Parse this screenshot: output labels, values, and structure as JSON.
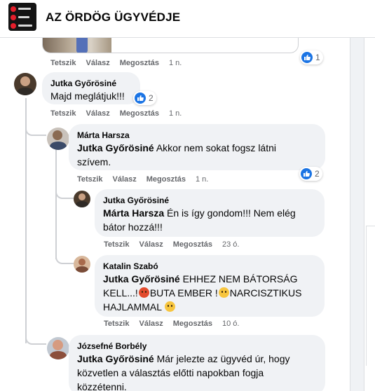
{
  "header": {
    "title": "AZ ÖRDÖG ÜGYVÉDJE"
  },
  "previous_comment": {
    "reactions": {
      "count": "1"
    },
    "actions": {
      "like": "Tetszik",
      "reply": "Válasz",
      "share": "Megosztás",
      "time": "1 n."
    }
  },
  "comments": [
    {
      "author": "Jutka Győrösiné",
      "text": "Majd meglátjuk!!!",
      "reactions": "2",
      "like": "Tetszik",
      "reply": "Válasz",
      "share": "Megosztás",
      "time": "1 n."
    },
    {
      "author": "Márta Harsza",
      "mention": "Jutka Győrösiné",
      "text_line1": " Akkor nem sokat fogsz látni",
      "text_line2": "szívem.",
      "reactions": "2",
      "like": "Tetszik",
      "reply": "Válasz",
      "share": "Megosztás",
      "time": "1 n."
    },
    {
      "author": "Jutka Győrösiné",
      "mention": "Márta Harsza",
      "text_line1": " Én is így gondom!!! Nem elég",
      "text_line2": "bátor hozzá!!!",
      "like": "Tetszik",
      "reply": "Válasz",
      "share": "Megosztás",
      "time": "23 ó."
    },
    {
      "author": "Katalin Szabó",
      "mention": "Jutka Győrösiné",
      "text_line1": " EHHEZ NEM BÁTORSÁG",
      "text_line2a": "KELL...!",
      "text_line2b": "BUTA EMBER !",
      "text_line2c": "NARCISZTIKUS",
      "text_line3": "HAJLAMMAL",
      "like": "Tetszik",
      "reply": "Válasz",
      "share": "Megosztás",
      "time": "10 ó."
    },
    {
      "author": "Józsefné Borbély",
      "mention": "Jutka Győrösiné",
      "text_line1": " Már jelezte az ügyvéd úr, hogy",
      "text_line2": "közvetlen a választás előtti napokban fogja",
      "text_line3": "közzétenni."
    }
  ],
  "colors": {
    "accent": "#1b74e4",
    "bubble": "#f0f2f5",
    "meta": "#65676b"
  },
  "icons": {
    "like": "thumbs-up-icon",
    "angry": "angry-face-emoji",
    "sad": "sad-face-emoji",
    "grin": "grinning-face-emoji"
  }
}
